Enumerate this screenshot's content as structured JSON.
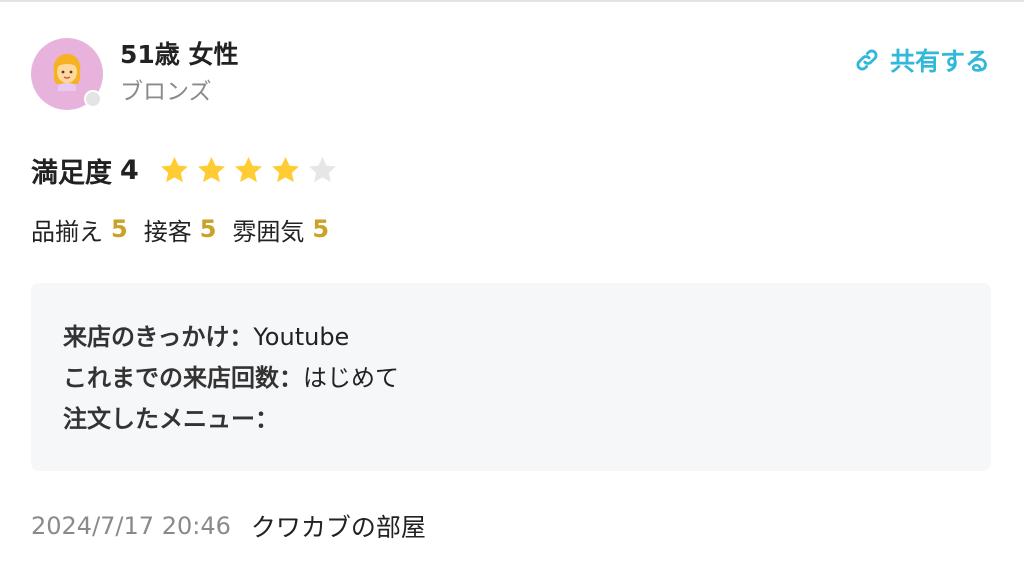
{
  "user": {
    "name": "51歳 女性",
    "rank": "ブロンズ",
    "avatar_icon": "woman-emoji-icon"
  },
  "share": {
    "label": "共有する",
    "icon": "link-icon",
    "color": "#32b8d8"
  },
  "rating": {
    "label": "満足度",
    "value": "4",
    "stars_filled": 4,
    "stars_total": 5,
    "star_color": "#ffcc33",
    "star_empty_color": "#e6e6e6"
  },
  "sub_ratings": [
    {
      "label": "品揃え",
      "value": "5"
    },
    {
      "label": "接客",
      "value": "5"
    },
    {
      "label": "雰囲気",
      "value": "5"
    }
  ],
  "details": [
    {
      "key": "来店のきっかけ：",
      "value": "Youtube"
    },
    {
      "key": "これまでの来店回数：",
      "value": "はじめて"
    },
    {
      "key": "注文したメニュー：",
      "value": ""
    }
  ],
  "footer": {
    "date": "2024/7/17 20:46",
    "shop": "クワカブの部屋"
  }
}
